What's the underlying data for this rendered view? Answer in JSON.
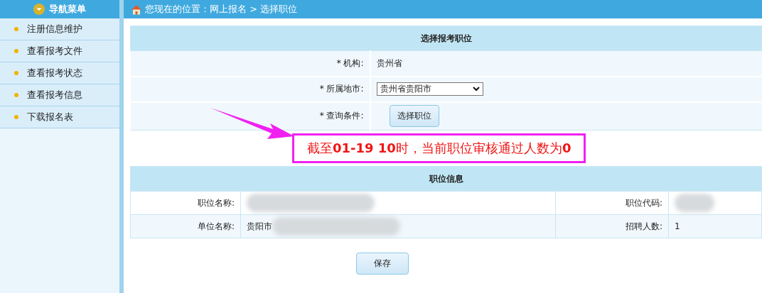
{
  "sidebar": {
    "title": "导航菜单",
    "items": [
      {
        "label": "注册信息维护"
      },
      {
        "label": "查看报考文件"
      },
      {
        "label": "查看报考状态"
      },
      {
        "label": "查看报考信息"
      },
      {
        "label": "下载报名表"
      }
    ]
  },
  "breadcrumb": {
    "prefix": "您现在的位置：",
    "path": [
      "网上报名",
      "选择职位"
    ],
    "separator": ">"
  },
  "form": {
    "title": "选择报考职位",
    "fields": [
      {
        "kind": "text",
        "label": "* 机构:",
        "value": "贵州省"
      },
      {
        "kind": "select",
        "label": "* 所属地市:",
        "value": "贵州省贵阳市"
      },
      {
        "kind": "button",
        "label": "* 查询条件:",
        "value": "选择职位"
      }
    ]
  },
  "notice": "截至**01-19 10**时，当前职位审核通过人数为**0**",
  "position_info": {
    "title": "职位信息",
    "rows": [
      {
        "label_1": "职位名称:",
        "value_1": "",
        "redacted_1": true,
        "label_2": "职位代码:",
        "value_2": "",
        "redacted_2": true
      },
      {
        "label_1": "单位名称:",
        "value_1": "贵阳市",
        "redacted_1": true,
        "label_2": "招聘人数:",
        "value_2": "1",
        "redacted_2": false
      }
    ]
  },
  "save_button": "保存"
}
